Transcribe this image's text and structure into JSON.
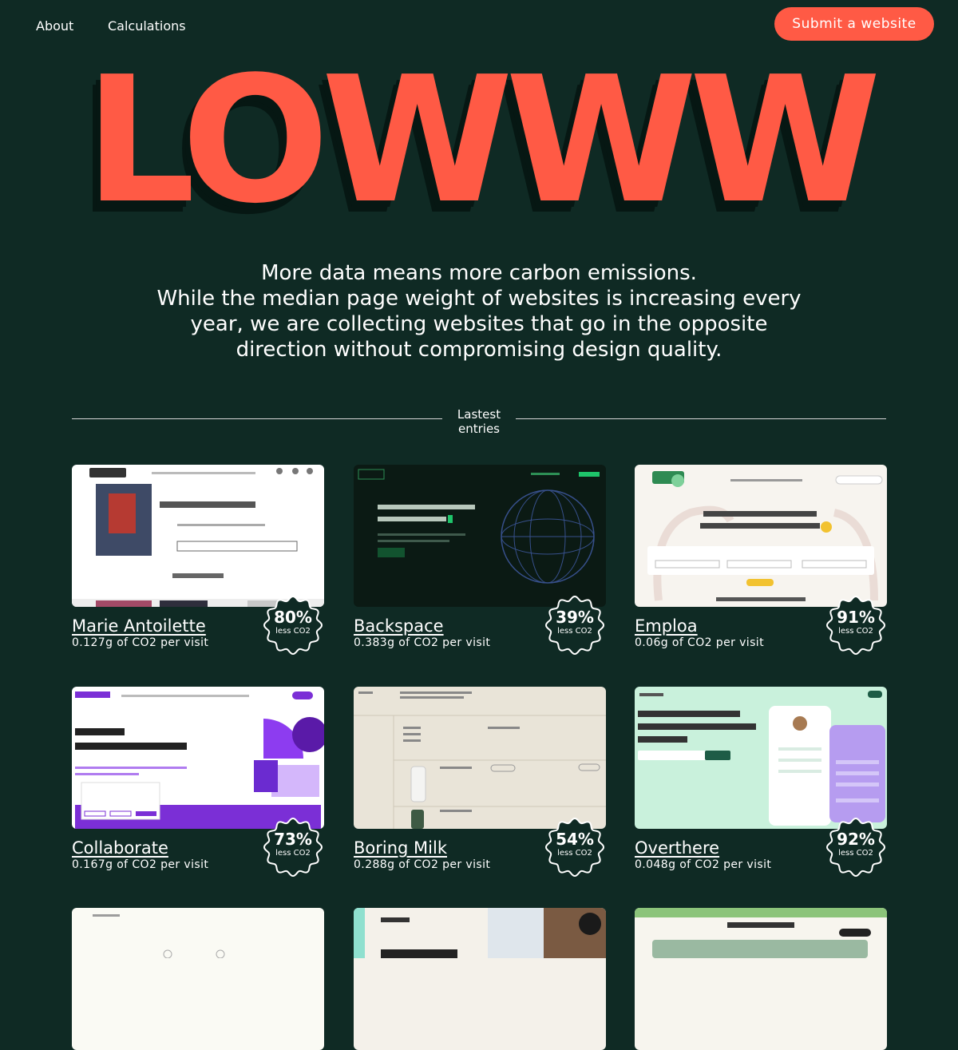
{
  "nav": {
    "about": "About",
    "calculations": "Calculations",
    "submit": "Submit a website"
  },
  "logo": "LOWWW",
  "intro": {
    "line1": "More data means more carbon emissions.",
    "line2": "While the median page weight of websites is increasing every",
    "line3": "year, we are collecting websites that go in the opposite",
    "line4": "direction without compromising design quality."
  },
  "section": {
    "title_line1": "Lastest",
    "title_line2": "entries"
  },
  "entries": [
    {
      "name": "Marie Antoilette",
      "co2": "0.127g of CO2 per visit",
      "percent": "80%",
      "less": "less CO2"
    },
    {
      "name": "Backspace",
      "co2": "0.383g of CO2 per visit",
      "percent": "39%",
      "less": "less CO2"
    },
    {
      "name": "Emploa",
      "co2": "0.06g of CO2 per visit",
      "percent": "91%",
      "less": "less CO2"
    },
    {
      "name": "Collaborate",
      "co2": "0.167g of CO2 per visit",
      "percent": "73%",
      "less": "less CO2"
    },
    {
      "name": "Boring Milk",
      "co2": "0.288g of CO2 per visit",
      "percent": "54%",
      "less": "less CO2"
    },
    {
      "name": "Overthere",
      "co2": "0.048g of CO2 per visit",
      "percent": "92%",
      "less": "less CO2"
    }
  ],
  "colors": {
    "background": "#0f2a24",
    "accent": "#ff5a45",
    "text": "#ffffff"
  }
}
